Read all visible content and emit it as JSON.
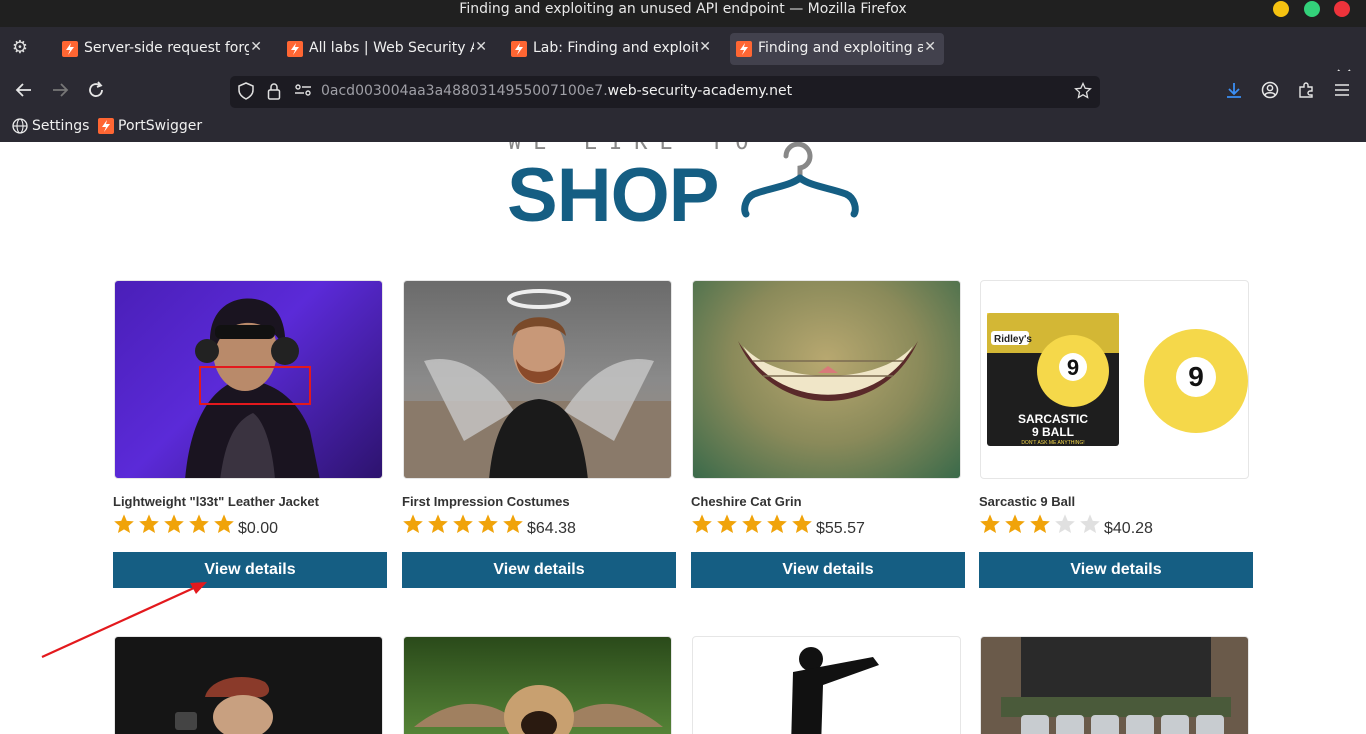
{
  "window": {
    "title": "Finding and exploiting an unused API endpoint — Mozilla Firefox"
  },
  "tabs": [
    {
      "label": "Server-side request forge",
      "active": false
    },
    {
      "label": "All labs | Web Security Ac",
      "active": false
    },
    {
      "label": "Lab: Finding and exploitin",
      "active": false
    },
    {
      "label": "Finding and exploiting an",
      "active": true
    }
  ],
  "url": {
    "prefix": "0acd003004aa3a4880314955007100e7.",
    "host": "web-security-academy.net"
  },
  "bookmarks": [
    {
      "label": "Settings",
      "icon": "globe-icon"
    },
    {
      "label": "PortSwigger",
      "icon": "portswigger-icon"
    }
  ],
  "logo": {
    "top": "WE LIKE TO",
    "main": "SHOP"
  },
  "products": [
    {
      "name": "Lightweight \"l33t\" Leather Jacket",
      "price": "$0.00",
      "rating": 5,
      "button": "View details"
    },
    {
      "name": "First Impression Costumes",
      "price": "$64.38",
      "rating": 5,
      "button": "View details"
    },
    {
      "name": "Cheshire Cat Grin",
      "price": "$55.57",
      "rating": 5,
      "button": "View details"
    },
    {
      "name": "Sarcastic 9 Ball",
      "price": "$40.28",
      "rating": 3,
      "button": "View details"
    }
  ],
  "sarcastic_box": {
    "brand": "Ridley's",
    "line1": "SARCASTIC",
    "line2": "9 BALL",
    "tagline": "DON'T ASK ME ANYTHING!",
    "number": "9"
  },
  "colors": {
    "accent": "#155e83",
    "star_on": "#f0a30a",
    "star_off": "#e0e0e0",
    "annotation": "#e3191d"
  }
}
